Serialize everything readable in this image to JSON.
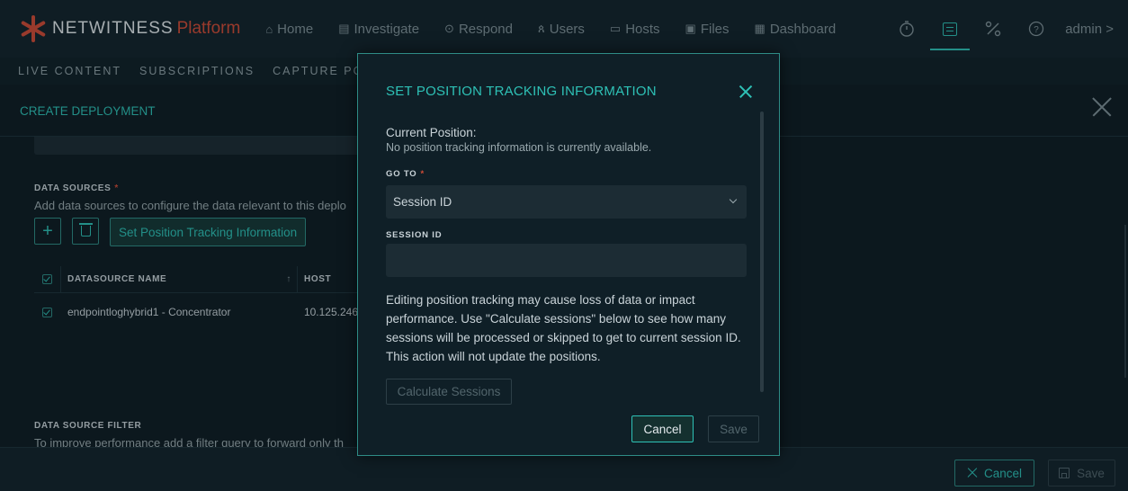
{
  "brand": {
    "name": "NETWITNESS",
    "product": "Platform"
  },
  "nav": {
    "items": [
      {
        "icon": "home-icon",
        "glyph": "⌂",
        "label": "Home"
      },
      {
        "icon": "investigate-icon",
        "glyph": "▤",
        "label": "Investigate"
      },
      {
        "icon": "respond-icon",
        "glyph": "⊙",
        "label": "Respond"
      },
      {
        "icon": "users-icon",
        "glyph": "ጰ",
        "label": "Users"
      },
      {
        "icon": "hosts-icon",
        "glyph": "▭",
        "label": "Hosts"
      },
      {
        "icon": "files-icon",
        "glyph": "▣",
        "label": "Files"
      },
      {
        "icon": "dashboard-icon",
        "glyph": "▦",
        "label": "Dashboard"
      }
    ],
    "right": {
      "user": "admin",
      "user_chevron": ">"
    }
  },
  "subnav": [
    "LIVE CONTENT",
    "SUBSCRIPTIONS",
    "CAPTURE POLI"
  ],
  "page": {
    "title": "CREATE DEPLOYMENT",
    "data_sources": {
      "label": "DATA SOURCES",
      "required": "*",
      "description": "Add data sources to configure the data relevant to this deplo",
      "set_position_button": "Set Position Tracking Information",
      "columns": [
        "DATASOURCE NAME",
        "HOST"
      ],
      "sort_glyph": "↑",
      "rows": [
        {
          "name": "endpointloghybrid1 - Concentrator",
          "host": "10.125.246"
        }
      ]
    },
    "filter": {
      "label": "DATA SOURCE FILTER",
      "description": "To improve performance add a filter query to forward only th"
    },
    "footer": {
      "cancel": "Cancel",
      "save": "Save"
    }
  },
  "modal": {
    "title": "SET POSITION TRACKING INFORMATION",
    "current_position_label": "Current Position:",
    "current_position_value": "No position tracking information is currently available.",
    "goto_label": "GO TO",
    "required": "*",
    "goto_selected": "Session ID",
    "session_id_label": "SESSION ID",
    "session_id_value": "",
    "warning": "Editing position tracking may cause loss of data or impact performance. Use \"Calculate sessions\" below to see how many sessions will be processed or skipped to get to current session ID. This action will not update the positions.",
    "calculate_button": "Calculate Sessions",
    "cancel_button": "Cancel",
    "save_button": "Save"
  }
}
